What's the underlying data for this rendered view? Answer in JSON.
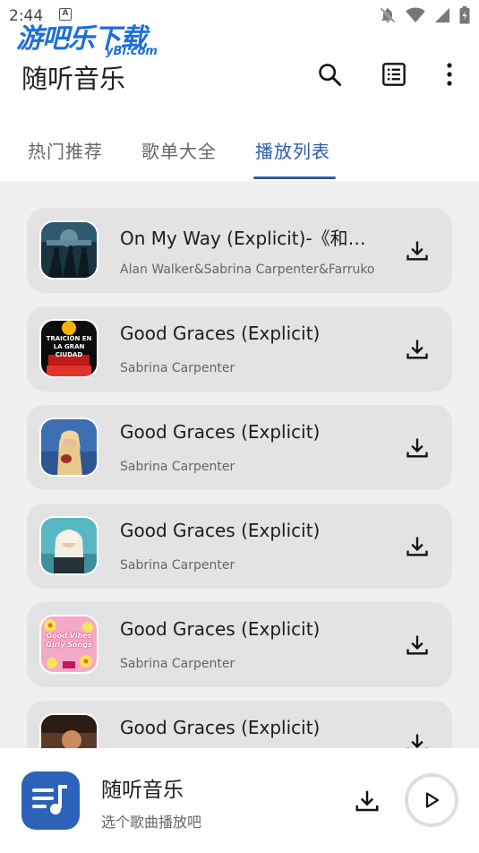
{
  "status_bar": {
    "time": "2:44",
    "indicator": "A",
    "icons": [
      "bell-off-icon",
      "wifi-icon",
      "signal-icon",
      "battery-icon"
    ]
  },
  "watermark": {
    "text": "游吧乐下载",
    "sub": "yBl.com"
  },
  "app_bar": {
    "title": "随听音乐",
    "actions": [
      "search-icon",
      "list-icon",
      "more-vert-icon"
    ]
  },
  "tabs": [
    {
      "label": "热门推荐",
      "active": false
    },
    {
      "label": "歌单大全",
      "active": false
    },
    {
      "label": "播放列表",
      "active": true
    }
  ],
  "accent_color": "#2b5dab",
  "songs": [
    {
      "title": "On My Way (Explicit)-《和平精英》游戏主题曲",
      "artist": "Alan Walker&Sabrina Carpenter&Farruko",
      "cover": "dark-scene",
      "cover_text": ""
    },
    {
      "title": "Good Graces (Explicit)",
      "artist": "Sabrina Carpenter",
      "cover": "red-poster",
      "cover_text": "TRAICIÓN EN LA GRAN CIUDAD"
    },
    {
      "title": "Good Graces (Explicit)",
      "artist": "Sabrina Carpenter",
      "cover": "blue-portrait",
      "cover_text": ""
    },
    {
      "title": "Good Graces (Explicit)",
      "artist": "Sabrina Carpenter",
      "cover": "teal-portrait",
      "cover_text": ""
    },
    {
      "title": "Good Graces (Explicit)",
      "artist": "Sabrina Carpenter",
      "cover": "pink-flowers",
      "cover_text": "Good Vibes Girly Songs"
    },
    {
      "title": "Good Graces (Explicit)",
      "artist": "",
      "cover": "brown-portrait",
      "cover_text": ""
    }
  ],
  "player": {
    "title": "随听音乐",
    "subtitle": "选个歌曲播放吧"
  }
}
